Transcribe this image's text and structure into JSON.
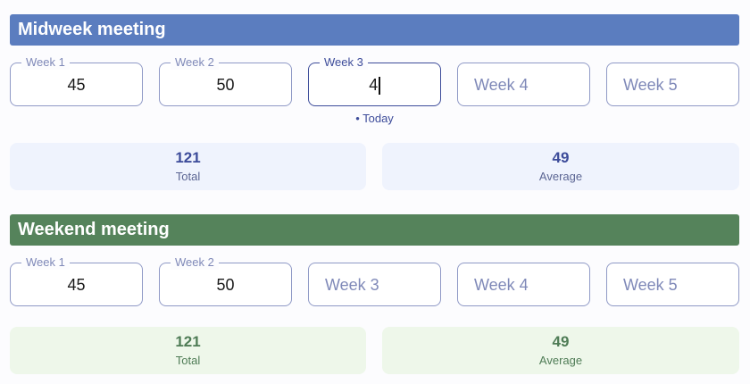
{
  "midweek": {
    "title": "Midweek meeting",
    "color": "#5b7dbf",
    "weeks": [
      {
        "label": "Week 1",
        "value": "45"
      },
      {
        "label": "Week 2",
        "value": "50"
      },
      {
        "label": "Week 3",
        "value": "4"
      },
      {
        "label": "Week 4",
        "value": ""
      },
      {
        "label": "Week 5",
        "value": ""
      }
    ],
    "today_label": "• Today",
    "total": {
      "value": "121",
      "label": "Total"
    },
    "average": {
      "value": "49",
      "label": "Average"
    }
  },
  "weekend": {
    "title": "Weekend meeting",
    "color": "#55835b",
    "weeks": [
      {
        "label": "Week 1",
        "value": "45"
      },
      {
        "label": "Week 2",
        "value": "50"
      },
      {
        "label": "Week 3",
        "value": ""
      },
      {
        "label": "Week 4",
        "value": ""
      },
      {
        "label": "Week 5",
        "value": ""
      }
    ],
    "total": {
      "value": "121",
      "label": "Total"
    },
    "average": {
      "value": "49",
      "label": "Average"
    }
  }
}
